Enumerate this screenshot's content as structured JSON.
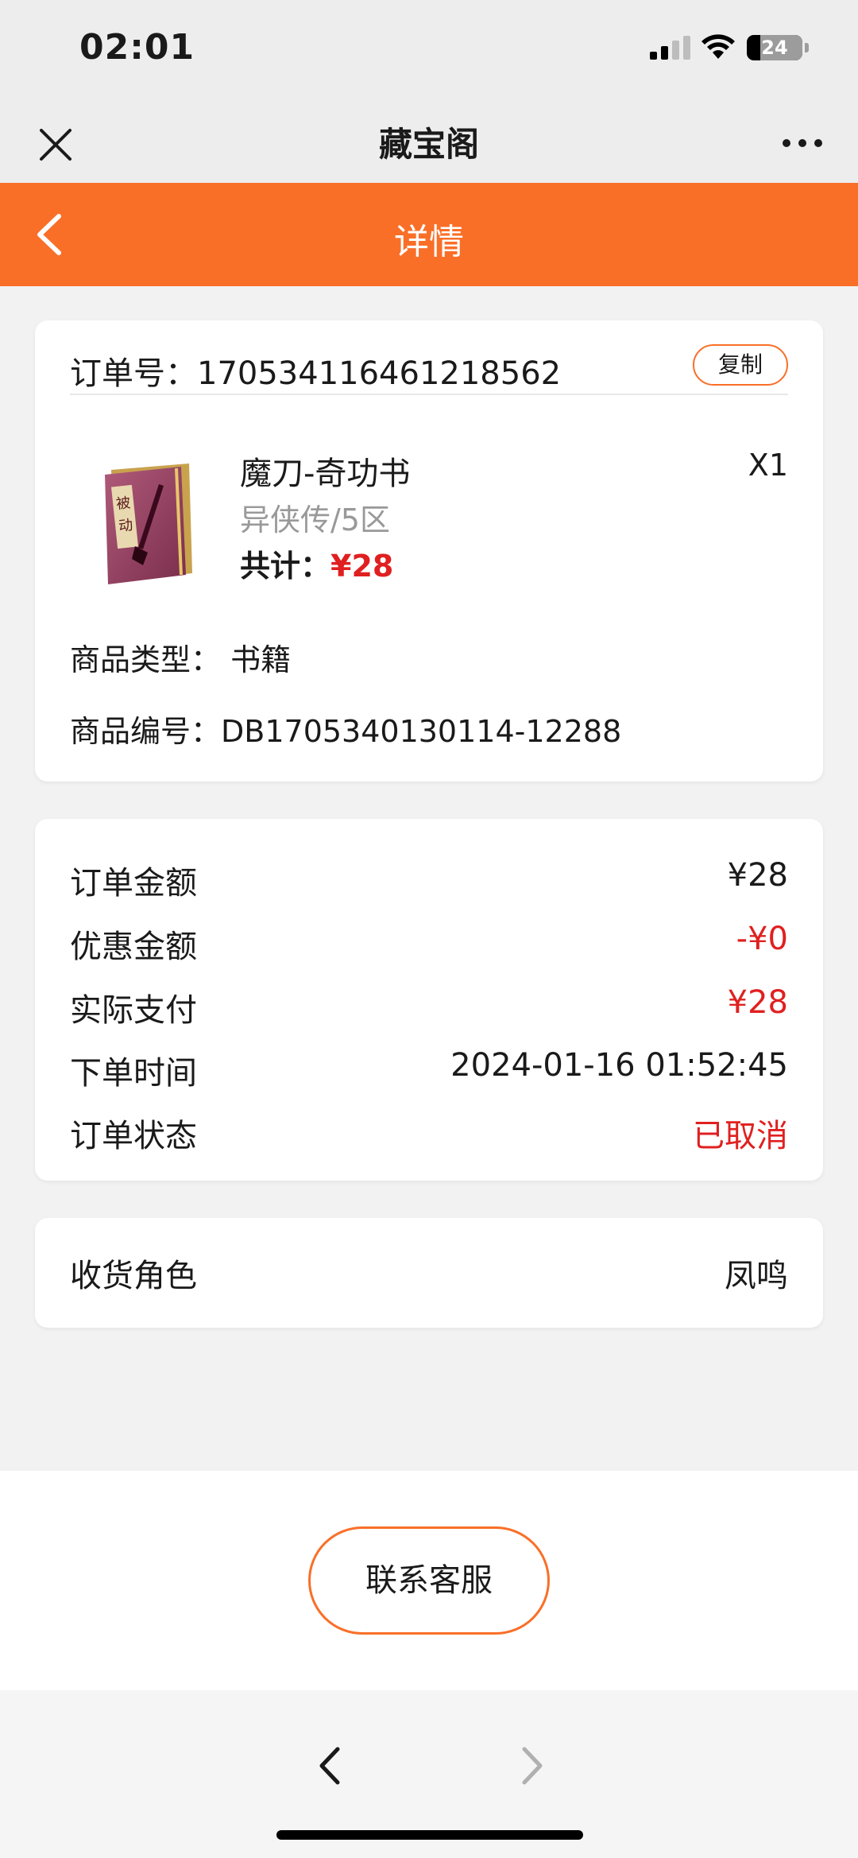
{
  "status_bar": {
    "time": "02:01",
    "battery": "24",
    "battery_level": 0.24,
    "icons": [
      "signal-icon",
      "wifi-icon",
      "battery-icon"
    ]
  },
  "app_bar": {
    "title": "藏宝阁",
    "icons": [
      "close-icon",
      "more-icon"
    ]
  },
  "header": {
    "title": "详情",
    "background": "#f96f28",
    "icons": [
      "back-arrow-icon"
    ]
  },
  "order": {
    "number_label": "订单号：",
    "number": "170534116461218562",
    "copy_label": "复制",
    "product": {
      "name": "魔刀-奇功书",
      "quantity": "X1",
      "server": "异侠传/5区",
      "total_label": "共计：",
      "total": "¥28",
      "image_icon": "skill-book-icon",
      "image_text": "被动"
    },
    "type_label": "商品类型：",
    "type_value": "书籍",
    "item_id_label": "商品编号：",
    "item_id": "DB1705340130114-12288"
  },
  "payment": {
    "rows": [
      {
        "label": "订单金额",
        "value": "¥28"
      },
      {
        "label": "优惠金额",
        "value": "-¥0"
      },
      {
        "label": "实际支付",
        "value": "¥28"
      },
      {
        "label": "下单时间",
        "value": "2024-01-16 01:52:45"
      },
      {
        "label": "订单状态",
        "value": "已取消"
      }
    ]
  },
  "receiver": {
    "label": "收货角色",
    "value": "凤鸣"
  },
  "actions": {
    "contact_label": "联系客服"
  },
  "navigation": {
    "icons": [
      "nav-back-icon",
      "nav-forward-icon"
    ]
  },
  "colors": {
    "accent": "#f96f28",
    "price_red": "#e02020",
    "muted": "#999999"
  }
}
